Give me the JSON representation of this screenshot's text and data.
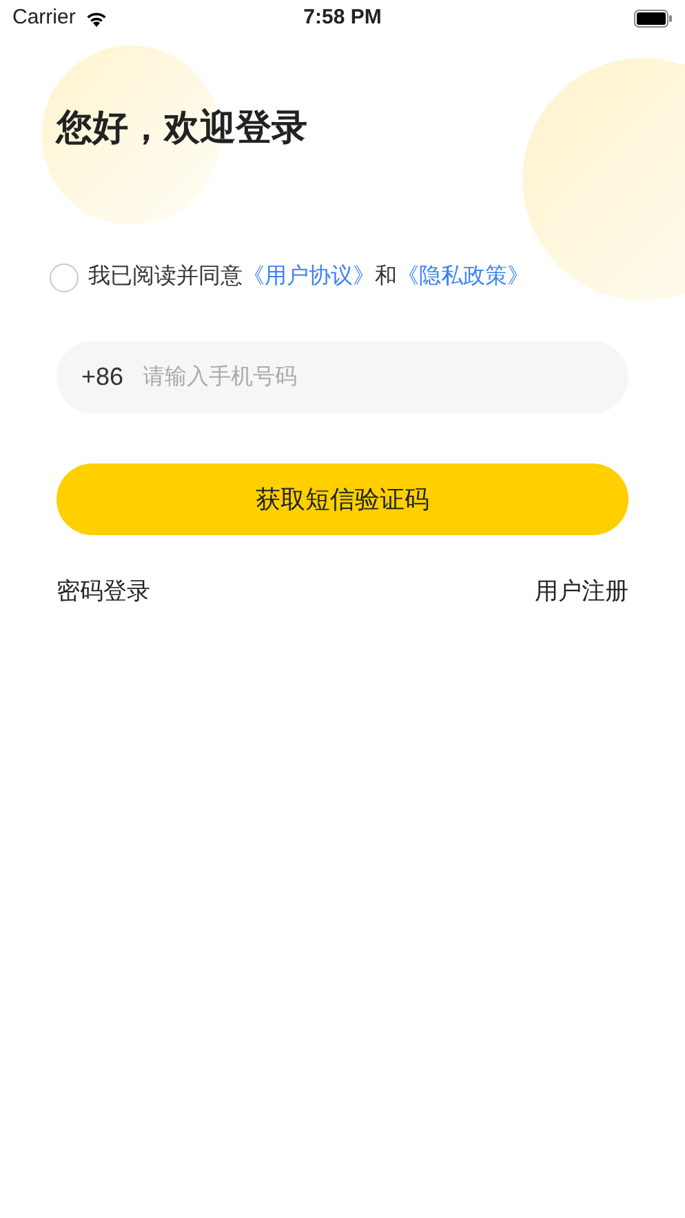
{
  "status_bar": {
    "carrier": "Carrier",
    "time": "7:58 PM"
  },
  "title": "您好，欢迎登录",
  "agreement": {
    "checked": false,
    "parts": [
      {
        "kind": "text",
        "text": "我已阅读并同意"
      },
      {
        "kind": "link",
        "text": "《用户协议》"
      },
      {
        "kind": "text",
        "text": "和"
      },
      {
        "kind": "link",
        "text": "《隐私政策》"
      }
    ]
  },
  "phone": {
    "prefix": "+86",
    "placeholder": "请输入手机号码"
  },
  "submit_button": "获取短信验证码",
  "links": [
    {
      "label": "密码登录"
    },
    {
      "label": "用户注册"
    }
  ]
}
